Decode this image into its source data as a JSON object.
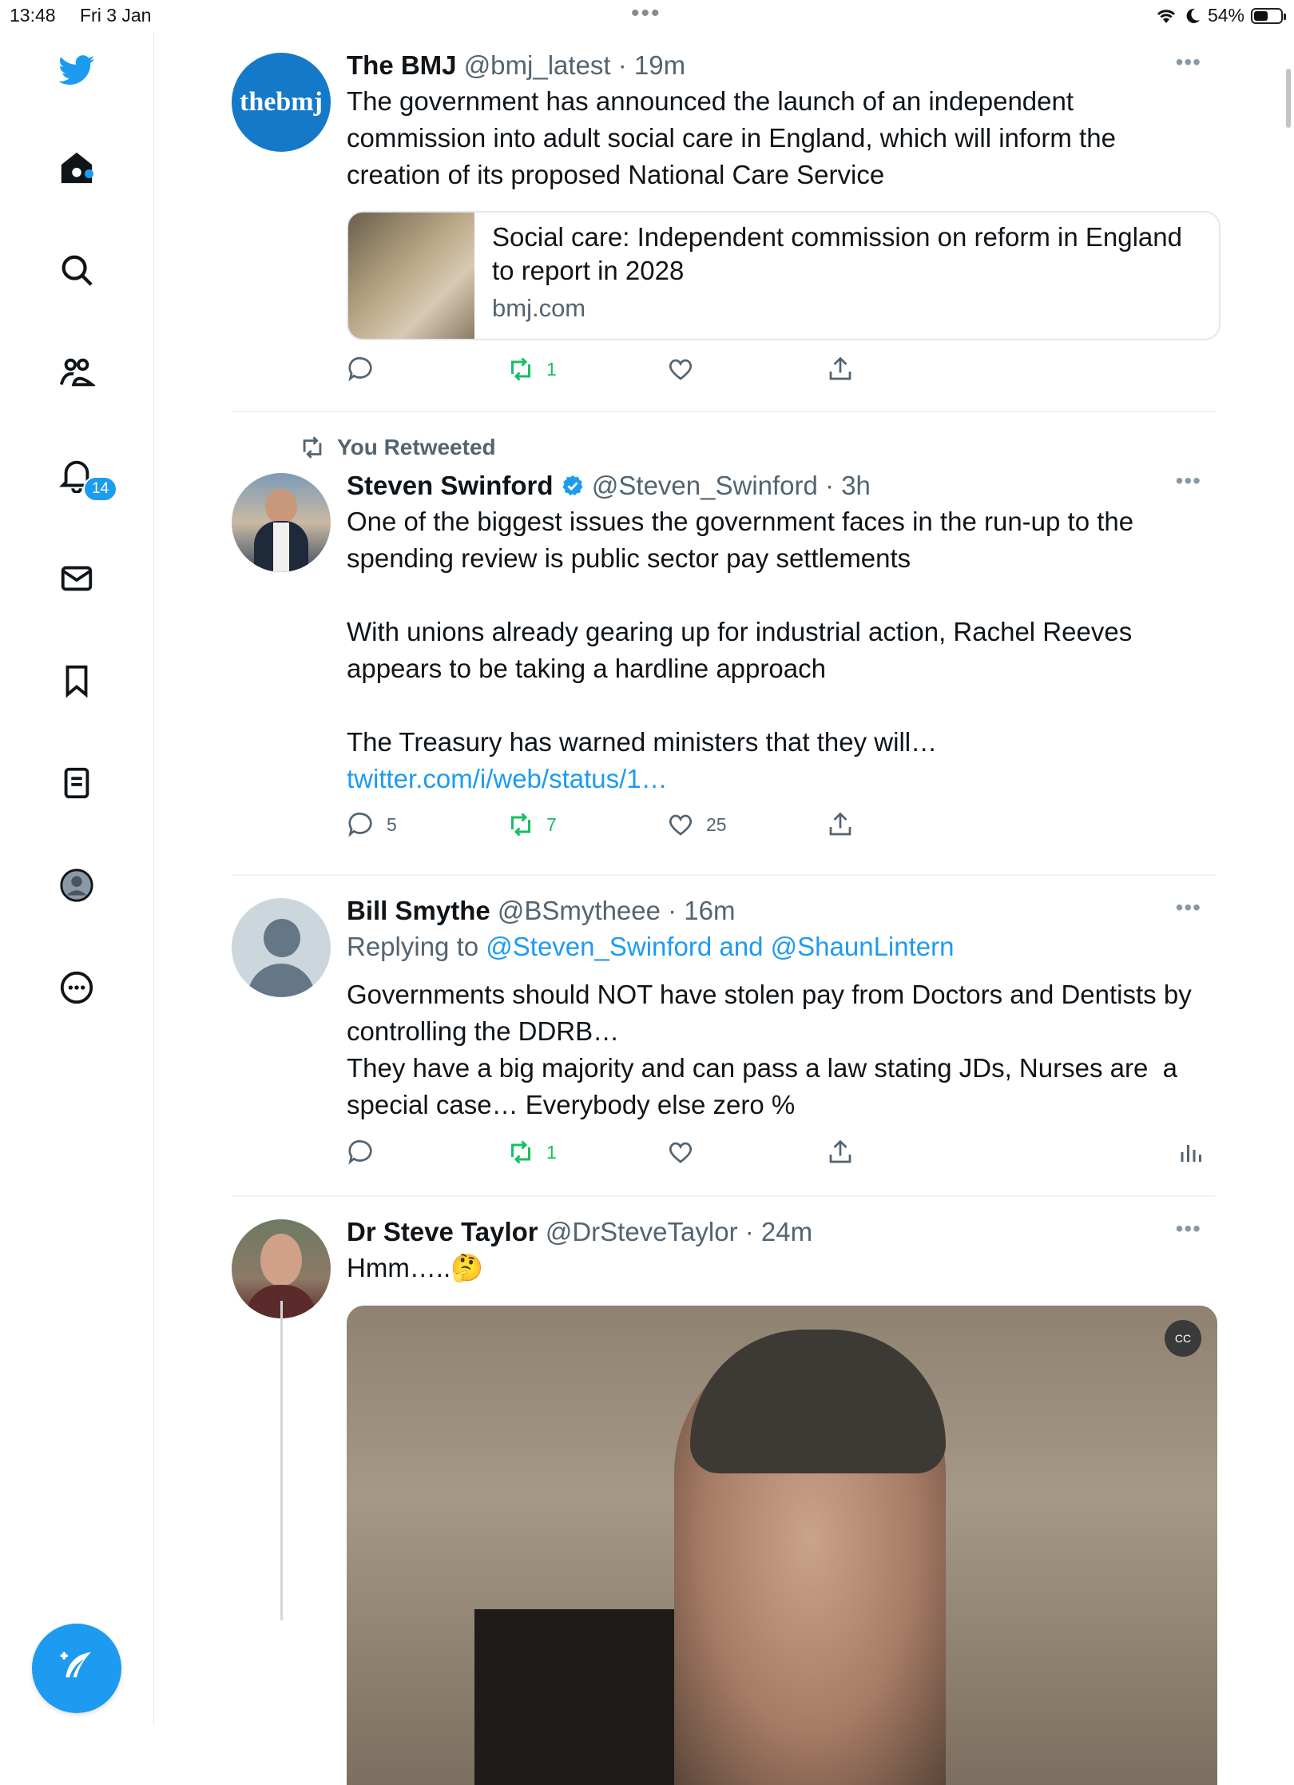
{
  "status_bar": {
    "time": "13:48",
    "date": "Fri 3 Jan",
    "battery": "54%"
  },
  "sidebar": {
    "notifications_badge": "14"
  },
  "tweets": [
    {
      "name": "The BMJ",
      "meta": "@bmj_latest · 19m",
      "avatar_text": "thebmj",
      "text": "The government has announced the launch of an independent commission into adult social care in England, which will inform the creation of its proposed National Care Service",
      "card": {
        "title": "Social care: Independent commission on reform in England to report in 2028",
        "domain": "bmj.com"
      },
      "retweets": "1"
    },
    {
      "context": "You Retweeted",
      "name": "Steven Swinford",
      "meta": "@Steven_Swinford · 3h",
      "text": "One of the biggest issues the government faces in the run-up to the spending review is public sector pay settlements\n\nWith unions already gearing up for industrial action, Rachel Reeves appears to be taking a hardline approach\n\nThe Treasury has warned ministers that they will… ",
      "link": "twitter.com/i/web/status/1…",
      "replies": "5",
      "retweets": "7",
      "likes": "25"
    },
    {
      "name": "Bill Smythe",
      "meta": "@BSmytheee · 16m",
      "replying_prefix": "Replying to ",
      "replying_to": "@Steven_Swinford and @ShaunLintern",
      "text": "Governments should NOT have stolen pay from Doctors and Dentists by controlling the DDRB…\nThey have a big majority and can pass a law stating JDs, Nurses are  a special case… Everybody else zero %",
      "retweets": "1"
    },
    {
      "name": "Dr Steve Taylor",
      "meta": "@DrSteveTaylor · 24m",
      "text": "Hmm…..🤔",
      "video_cc": "CC"
    }
  ]
}
